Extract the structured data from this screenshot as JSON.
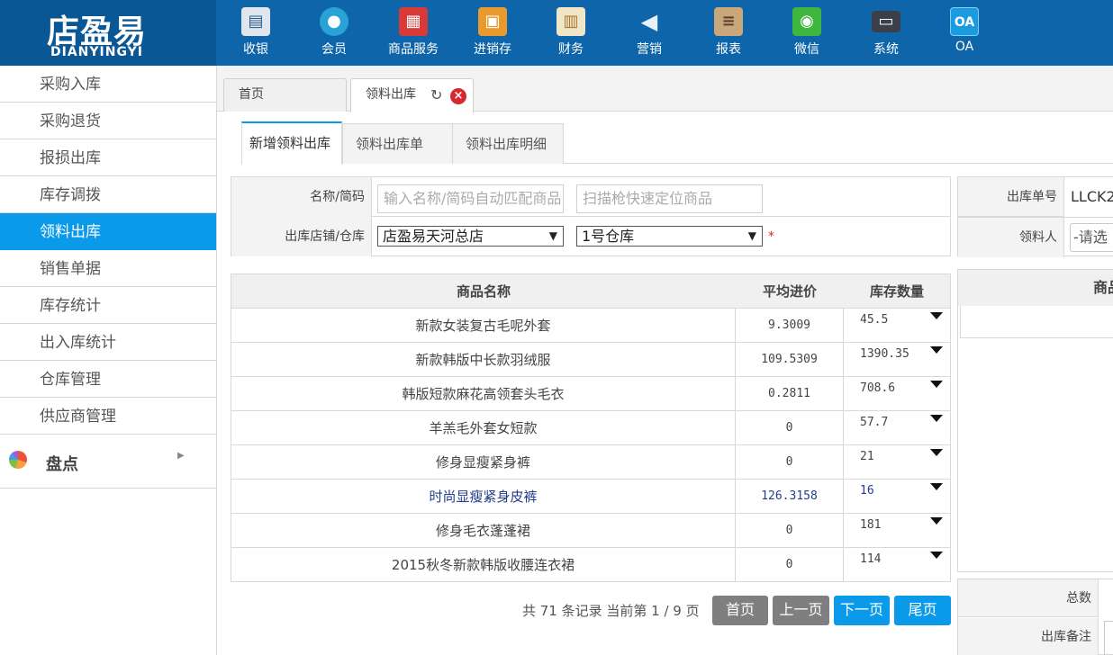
{
  "brand": {
    "name_cn": "店盈易",
    "name_en": "DIANYINGYI",
    "color": "#0e65a9"
  },
  "top_nav": [
    {
      "label": "收银",
      "icon": "cash-register-icon",
      "color": "#2c7fb8"
    },
    {
      "label": "会员",
      "icon": "member-icon",
      "color": "#29a3d6"
    },
    {
      "label": "商品服务",
      "icon": "goods-icon",
      "color": "#d83a3a"
    },
    {
      "label": "进销存",
      "icon": "inventory-icon",
      "color": "#e89a2e"
    },
    {
      "label": "财务",
      "icon": "finance-icon",
      "color": "#e9b53a"
    },
    {
      "label": "营销",
      "icon": "marketing-icon",
      "color": "#4aa3e0"
    },
    {
      "label": "报表",
      "icon": "report-icon",
      "color": "#9a7a56"
    },
    {
      "label": "微信",
      "icon": "wechat-icon",
      "color": "#3fb63f"
    },
    {
      "label": "系统",
      "icon": "system-icon",
      "color": "#3a3f4a"
    },
    {
      "label": "OA",
      "icon": "oa-icon",
      "color": "#1a9be0",
      "badge": "OA"
    }
  ],
  "sidebar": {
    "items": [
      {
        "label": "采购入库"
      },
      {
        "label": "采购退货"
      },
      {
        "label": "报损出库"
      },
      {
        "label": "库存调拨"
      },
      {
        "label": "领料出库",
        "active": true
      },
      {
        "label": "销售单据"
      },
      {
        "label": "库存统计"
      },
      {
        "label": "出入库统计"
      },
      {
        "label": "仓库管理"
      },
      {
        "label": "供应商管理"
      }
    ],
    "group": {
      "label": "盘点",
      "icon": "pie-chart-icon"
    }
  },
  "main_tabs": {
    "home": "首页",
    "active": "领料出库"
  },
  "sub_tabs": [
    "新增领料出库",
    "领料出库单",
    "领料出库明细"
  ],
  "form": {
    "name_label": "名称/简码",
    "name_placeholder": "输入名称/简码自动匹配商品",
    "scan_placeholder": "扫描枪快速定位商品",
    "store_label": "出库店铺/仓库",
    "store_value": "店盈易天河总店",
    "warehouse_value": "1号仓库",
    "required": "*"
  },
  "right_panel": {
    "order_label": "出库单号",
    "order_value": "LLCK2",
    "receiver_label": "领料人",
    "receiver_value": "-请选",
    "table_head": "商品",
    "total_label": "总数",
    "remark_label": "出库备注"
  },
  "table": {
    "headers": {
      "name": "商品名称",
      "price": "平均进价",
      "qty": "库存数量"
    },
    "rows": [
      {
        "name": "新款女装复古毛呢外套",
        "price": "9.3009",
        "qty": "45.5"
      },
      {
        "name": "新款韩版中长款羽绒服",
        "price": "109.5309",
        "qty": "1390.35"
      },
      {
        "name": "韩版短款麻花高领套头毛衣",
        "price": "0.2811",
        "qty": "708.6"
      },
      {
        "name": "羊羔毛外套女短款",
        "price": "0",
        "qty": "57.7"
      },
      {
        "name": "修身显瘦紧身裤",
        "price": "0",
        "qty": "21"
      },
      {
        "name": "时尚显瘦紧身皮裤",
        "price": "126.3158",
        "qty": "16",
        "highlight": true
      },
      {
        "name": "修身毛衣蓬蓬裙",
        "price": "0",
        "qty": "181"
      },
      {
        "name": "2015秋冬新款韩版收腰连衣裙",
        "price": "0",
        "qty": "114"
      }
    ]
  },
  "pager": {
    "info": "共 71 条记录 当前第 1 / 9 页",
    "first": "首页",
    "prev": "上一页",
    "next": "下一页",
    "last": "尾页"
  }
}
